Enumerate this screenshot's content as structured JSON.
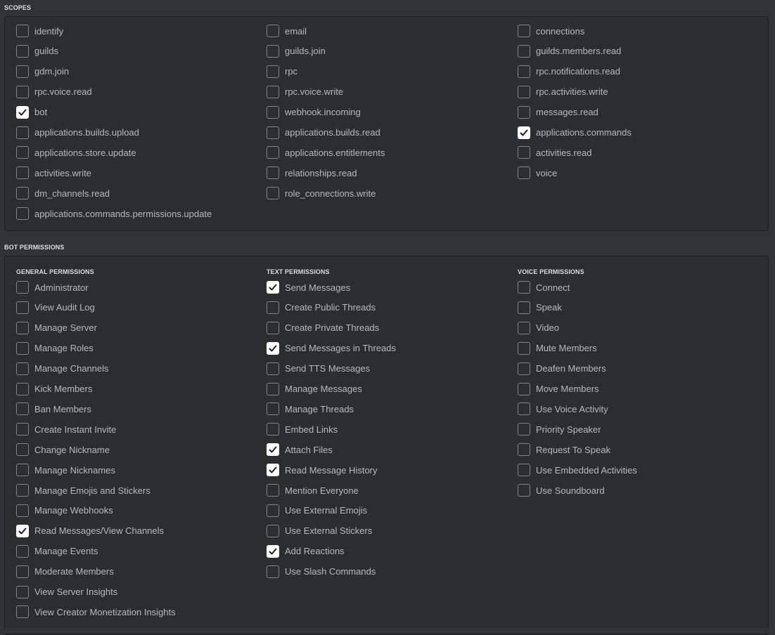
{
  "scopes": {
    "title": "SCOPES",
    "columns": [
      [
        {
          "label": "identify",
          "checked": false
        },
        {
          "label": "guilds",
          "checked": false
        },
        {
          "label": "gdm.join",
          "checked": false
        },
        {
          "label": "rpc.voice.read",
          "checked": false
        },
        {
          "label": "bot",
          "checked": true
        },
        {
          "label": "applications.builds.upload",
          "checked": false
        },
        {
          "label": "applications.store.update",
          "checked": false
        },
        {
          "label": "activities.write",
          "checked": false
        },
        {
          "label": "dm_channels.read",
          "checked": false
        },
        {
          "label": "applications.commands.permissions.update",
          "checked": false
        }
      ],
      [
        {
          "label": "email",
          "checked": false
        },
        {
          "label": "guilds.join",
          "checked": false
        },
        {
          "label": "rpc",
          "checked": false
        },
        {
          "label": "rpc.voice.write",
          "checked": false
        },
        {
          "label": "webhook.incoming",
          "checked": false
        },
        {
          "label": "applications.builds.read",
          "checked": false
        },
        {
          "label": "applications.entitlements",
          "checked": false
        },
        {
          "label": "relationships.read",
          "checked": false
        },
        {
          "label": "role_connections.write",
          "checked": false
        }
      ],
      [
        {
          "label": "connections",
          "checked": false
        },
        {
          "label": "guilds.members.read",
          "checked": false
        },
        {
          "label": "rpc.notifications.read",
          "checked": false
        },
        {
          "label": "rpc.activities.write",
          "checked": false
        },
        {
          "label": "messages.read",
          "checked": false
        },
        {
          "label": "applications.commands",
          "checked": true
        },
        {
          "label": "activities.read",
          "checked": false
        },
        {
          "label": "voice",
          "checked": false
        }
      ]
    ]
  },
  "bot_permissions": {
    "title": "BOT PERMISSIONS",
    "columns": [
      {
        "title": "GENERAL PERMISSIONS",
        "items": [
          {
            "label": "Administrator",
            "checked": false
          },
          {
            "label": "View Audit Log",
            "checked": false
          },
          {
            "label": "Manage Server",
            "checked": false
          },
          {
            "label": "Manage Roles",
            "checked": false
          },
          {
            "label": "Manage Channels",
            "checked": false
          },
          {
            "label": "Kick Members",
            "checked": false
          },
          {
            "label": "Ban Members",
            "checked": false
          },
          {
            "label": "Create Instant Invite",
            "checked": false
          },
          {
            "label": "Change Nickname",
            "checked": false
          },
          {
            "label": "Manage Nicknames",
            "checked": false
          },
          {
            "label": "Manage Emojis and Stickers",
            "checked": false
          },
          {
            "label": "Manage Webhooks",
            "checked": false
          },
          {
            "label": "Read Messages/View Channels",
            "checked": true
          },
          {
            "label": "Manage Events",
            "checked": false
          },
          {
            "label": "Moderate Members",
            "checked": false
          },
          {
            "label": "View Server Insights",
            "checked": false
          },
          {
            "label": "View Creator Monetization Insights",
            "checked": false
          }
        ]
      },
      {
        "title": "TEXT PERMISSIONS",
        "items": [
          {
            "label": "Send Messages",
            "checked": true
          },
          {
            "label": "Create Public Threads",
            "checked": false
          },
          {
            "label": "Create Private Threads",
            "checked": false
          },
          {
            "label": "Send Messages in Threads",
            "checked": true
          },
          {
            "label": "Send TTS Messages",
            "checked": false
          },
          {
            "label": "Manage Messages",
            "checked": false
          },
          {
            "label": "Manage Threads",
            "checked": false
          },
          {
            "label": "Embed Links",
            "checked": false
          },
          {
            "label": "Attach Files",
            "checked": true
          },
          {
            "label": "Read Message History",
            "checked": true
          },
          {
            "label": "Mention Everyone",
            "checked": false
          },
          {
            "label": "Use External Emojis",
            "checked": false
          },
          {
            "label": "Use External Stickers",
            "checked": false
          },
          {
            "label": "Add Reactions",
            "checked": true
          },
          {
            "label": "Use Slash Commands",
            "checked": false
          }
        ]
      },
      {
        "title": "VOICE PERMISSIONS",
        "items": [
          {
            "label": "Connect",
            "checked": false
          },
          {
            "label": "Speak",
            "checked": false
          },
          {
            "label": "Video",
            "checked": false
          },
          {
            "label": "Mute Members",
            "checked": false
          },
          {
            "label": "Deafen Members",
            "checked": false
          },
          {
            "label": "Move Members",
            "checked": false
          },
          {
            "label": "Use Voice Activity",
            "checked": false
          },
          {
            "label": "Priority Speaker",
            "checked": false
          },
          {
            "label": "Request To Speak",
            "checked": false
          },
          {
            "label": "Use Embedded Activities",
            "checked": false
          },
          {
            "label": "Use Soundboard",
            "checked": false
          }
        ]
      }
    ]
  },
  "icons": {
    "check": "checkmark-icon"
  },
  "colors": {
    "background": "#313338",
    "panel": "#2b2d31",
    "checkbox_border": "#80848e",
    "checked_fill": "#ffffff",
    "label": "#b5bac1"
  }
}
